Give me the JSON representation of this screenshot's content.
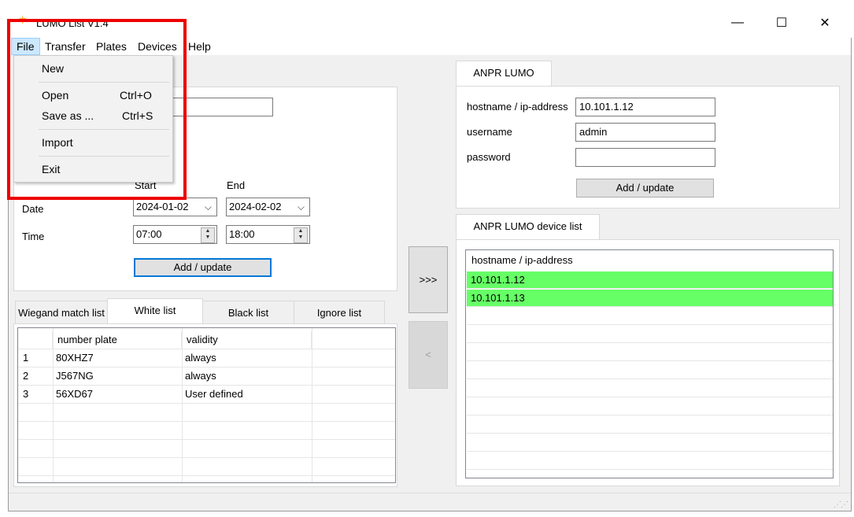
{
  "app": {
    "title": "LUMO List V1.4"
  },
  "window_controls": {
    "minimize": "—",
    "maximize": "☐",
    "close": "✕"
  },
  "menubar": {
    "file": "File",
    "transfer": "Transfer",
    "plates": "Plates",
    "devices": "Devices",
    "help": "Help"
  },
  "file_menu": {
    "new": "New",
    "open": "Open",
    "open_shortcut": "Ctrl+O",
    "save_as": "Save as ...",
    "save_as_shortcut": "Ctrl+S",
    "import": "Import",
    "exit": "Exit"
  },
  "entry": {
    "start_label": "Start",
    "end_label": "End",
    "date_label": "Date",
    "time_label": "Time",
    "start_date": "2024-01-02",
    "end_date": "2024-02-02",
    "start_time": "07:00",
    "end_time": "18:00",
    "add_update": "Add / update"
  },
  "list_tabs": [
    "Wiegand match list",
    "White list",
    "Black list",
    "Ignore list"
  ],
  "plate_table": {
    "headers": [
      "number plate",
      "validity"
    ],
    "rows": [
      {
        "idx": "1",
        "plate": "80XHZ7",
        "validity": "always"
      },
      {
        "idx": "2",
        "plate": "J567NG",
        "validity": "always"
      },
      {
        "idx": "3",
        "plate": "56XD67",
        "validity": "User defined"
      }
    ]
  },
  "transfer": {
    "forward": ">>>",
    "back": "<"
  },
  "anpr": {
    "tab": "ANPR LUMO",
    "hostname_label": "hostname / ip-address",
    "hostname_value": "10.101.1.12",
    "username_label": "username",
    "username_value": "admin",
    "password_label": "password",
    "password_value": "",
    "add_update": "Add / update"
  },
  "device_list": {
    "tab": "ANPR LUMO device list",
    "header": "hostname / ip-address",
    "items": [
      "10.101.1.12",
      "10.101.1.13"
    ]
  },
  "colors": {
    "active_row": "#66ff66",
    "highlight": "#ee0000",
    "menu_hover": "#cce8ff"
  }
}
